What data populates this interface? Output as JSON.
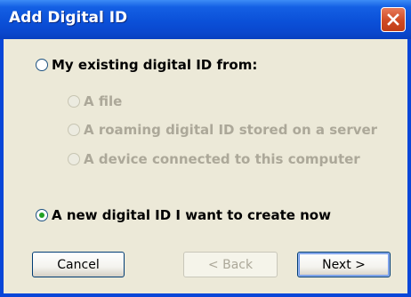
{
  "window": {
    "title": "Add Digital ID"
  },
  "options": {
    "existing": {
      "label": "My existing digital ID from:",
      "selected": false
    },
    "file": {
      "label": "A file",
      "enabled": false
    },
    "roaming": {
      "label": "A roaming digital ID stored on a server",
      "enabled": false
    },
    "device": {
      "label": "A device connected to this computer",
      "enabled": false
    },
    "new_id": {
      "label": "A new digital ID I want to create now",
      "selected": true
    }
  },
  "buttons": {
    "cancel": "Cancel",
    "back": "< Back",
    "next": "Next >"
  },
  "colors": {
    "title_bar": "#0a4ed8",
    "dialog_background": "#ece9d8",
    "close_button": "#d4532c",
    "radio_selected_dot": "#21a121",
    "disabled_text": "#aca899"
  }
}
